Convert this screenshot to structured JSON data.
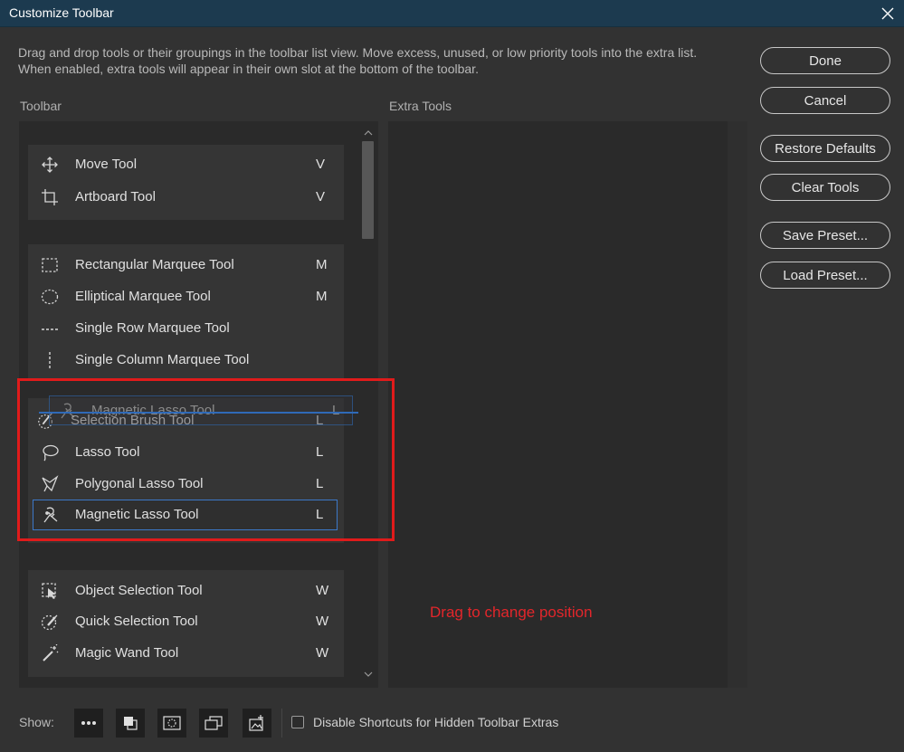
{
  "window": {
    "title": "Customize Toolbar"
  },
  "description": "Drag and drop tools or their groupings in the toolbar list view. Move excess, unused, or low priority tools into the extra list. When enabled, extra tools will appear in their own slot at the bottom of the toolbar.",
  "toolbar_label": "Toolbar",
  "extra_label": "Extra Tools",
  "groups": [
    {
      "tools": [
        {
          "name": "Move Tool",
          "key": "V",
          "icon": "move-icon"
        },
        {
          "name": "Artboard Tool",
          "key": "V",
          "icon": "artboard-icon"
        }
      ]
    },
    {
      "tools": [
        {
          "name": "Rectangular Marquee Tool",
          "key": "M",
          "icon": "rectangular-marquee-icon"
        },
        {
          "name": "Elliptical Marquee Tool",
          "key": "M",
          "icon": "elliptical-marquee-icon"
        },
        {
          "name": "Single Row Marquee Tool",
          "key": "",
          "icon": "single-row-marquee-icon"
        },
        {
          "name": "Single Column Marquee Tool",
          "key": "",
          "icon": "single-column-marquee-icon"
        }
      ]
    },
    {
      "tools": [
        {
          "name": "Selection Brush Tool",
          "key": "L",
          "icon": "selection-brush-icon"
        },
        {
          "name": "Lasso Tool",
          "key": "L",
          "icon": "lasso-icon"
        },
        {
          "name": "Polygonal Lasso Tool",
          "key": "L",
          "icon": "polygonal-lasso-icon"
        },
        {
          "name": "Magnetic Lasso Tool",
          "key": "L",
          "icon": "magnetic-lasso-icon",
          "selected": true
        }
      ]
    },
    {
      "tools": [
        {
          "name": "Object Selection Tool",
          "key": "W",
          "icon": "object-selection-icon"
        },
        {
          "name": "Quick Selection Tool",
          "key": "W",
          "icon": "quick-selection-icon"
        },
        {
          "name": "Magic Wand Tool",
          "key": "W",
          "icon": "magic-wand-icon"
        }
      ]
    }
  ],
  "drag_ghost": {
    "name": "Magnetic Lasso Tool",
    "key": "L",
    "icon": "magnetic-lasso-icon"
  },
  "annotation": {
    "text": "Drag to change position",
    "color": "#e01b1b"
  },
  "buttons": {
    "done": "Done",
    "cancel": "Cancel",
    "restore": "Restore Defaults",
    "clear": "Clear Tools",
    "save": "Save Preset...",
    "load": "Load Preset..."
  },
  "footer": {
    "show_label": "Show:",
    "show_buttons": [
      "more-icon",
      "foreground-background-icon",
      "quick-mask-icon",
      "screen-mode-icon",
      "edit-toolbar-icon"
    ],
    "checkbox_label": "Disable Shortcuts for Hidden Toolbar Extras",
    "checkbox_checked": false
  },
  "colors": {
    "selection_border": "#3c78c8",
    "titlebar": "#1c3a4f"
  }
}
